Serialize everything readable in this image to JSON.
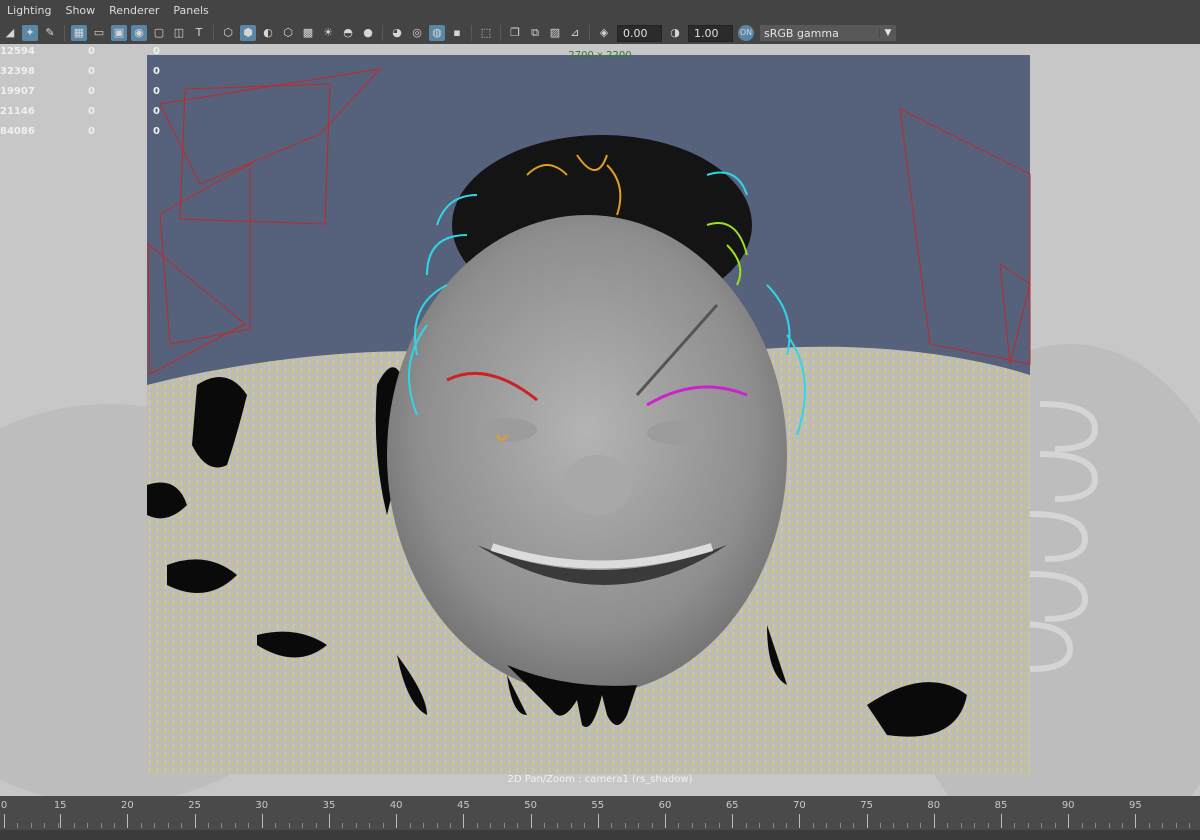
{
  "menu": {
    "items": [
      "Lighting",
      "Show",
      "Renderer",
      "Panels"
    ]
  },
  "toolbar": {
    "exposure_value": "0.00",
    "gamma_value": "1.00",
    "color_space": "sRGB gamma",
    "icons": [
      "camera-attributes-icon",
      "bookmark-icon",
      "pencil-icon",
      "grid-icon",
      "film-gate-icon",
      "resolution-gate-icon",
      "gate-mask-icon",
      "field-chart-icon",
      "safe-action-icon",
      "safe-title-icon",
      "wireframe-icon",
      "smooth-shade-icon",
      "flat-shade-icon",
      "bounding-box-icon",
      "textured-icon",
      "lights-icon",
      "shadows-icon",
      "ambient-occlusion-icon",
      "motion-blur-icon",
      "isolate-select-icon",
      "xray-icon",
      "xray-joints-icon",
      "cursor-select-icon",
      "two-d-pan-zoom-icon",
      "grease-pencil-icon",
      "image-plane-icon",
      "exposure-icon",
      "gamma-icon",
      "color-management-icon"
    ]
  },
  "hud": {
    "stats": [
      [
        "12594",
        "0",
        "0"
      ],
      [
        "32398",
        "0",
        "0"
      ],
      [
        "19907",
        "0",
        "0"
      ],
      [
        "21146",
        "0",
        "0"
      ],
      [
        "84086",
        "0",
        "0"
      ]
    ],
    "resolution": "2700 x 2200",
    "camera_label": "2D Pan/Zoom : camera1 (rs_shadow)"
  },
  "timeline": {
    "ticks": [
      "0",
      "15",
      "20",
      "25",
      "30",
      "35",
      "40",
      "45",
      "50",
      "55",
      "60",
      "65",
      "70",
      "75",
      "80",
      "85",
      "90",
      "95"
    ]
  },
  "colors": {
    "ui_bg": "#444444",
    "accent": "#5a87a6",
    "sky": "#55607a",
    "camera_wire": "#c0282a",
    "fur": "#e6d25a"
  }
}
